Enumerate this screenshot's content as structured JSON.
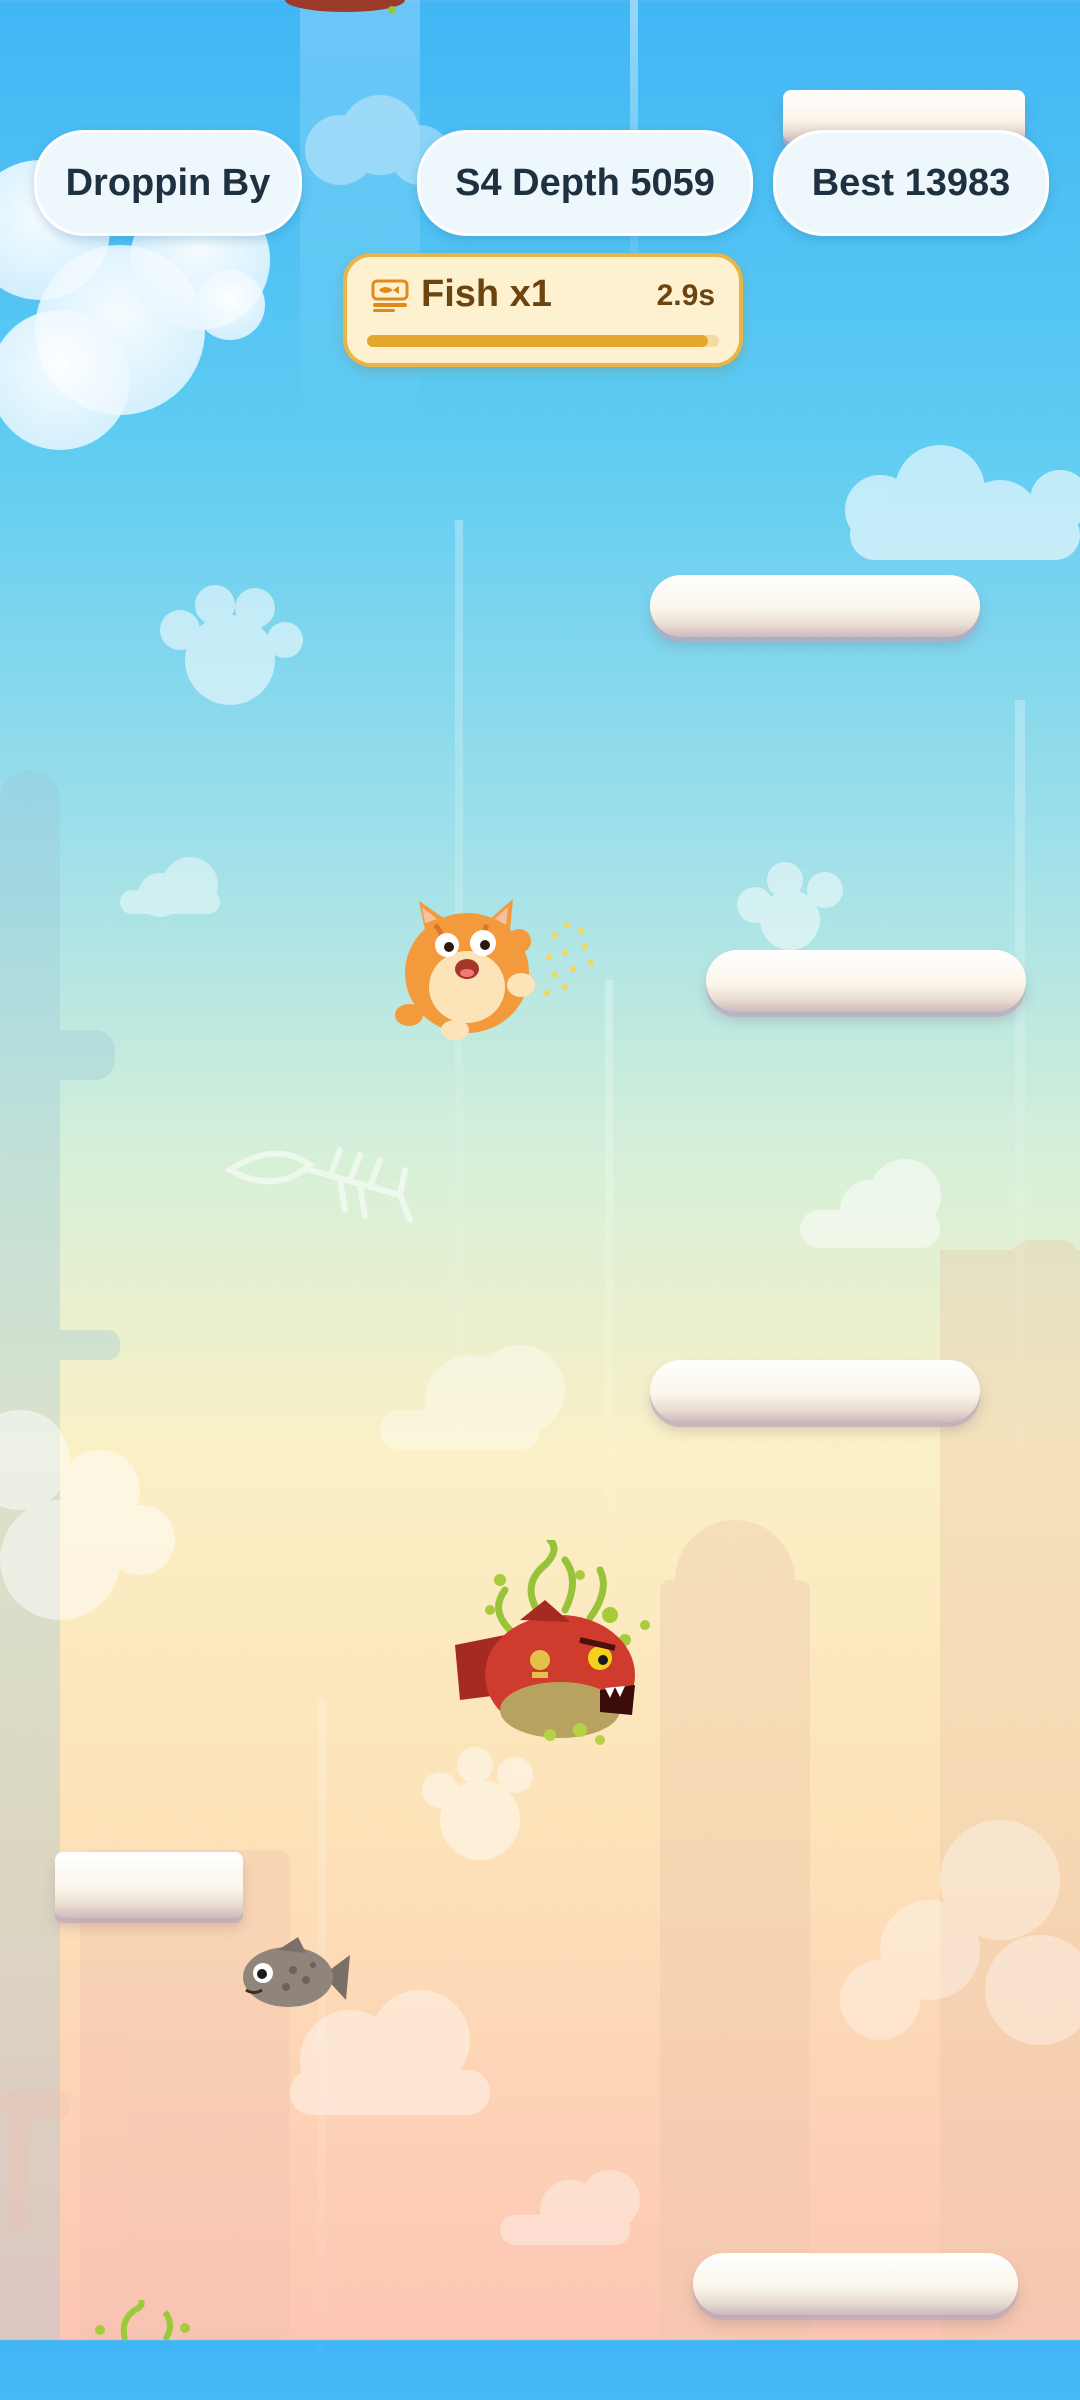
{
  "hud": {
    "mode_label": "Droppin By",
    "depth_label": "S4 Depth 5059",
    "best_label": "Best 13983"
  },
  "powerup": {
    "label": "Fish x1",
    "timer": "2.9s",
    "progress": 0.97,
    "icon": "fish-bowl-icon"
  },
  "colors": {
    "sky_top": "#41b6f5",
    "sky_bottom": "#fdc6b4",
    "hud_text": "#1f3140",
    "powerup_accent": "#e6a62b"
  }
}
